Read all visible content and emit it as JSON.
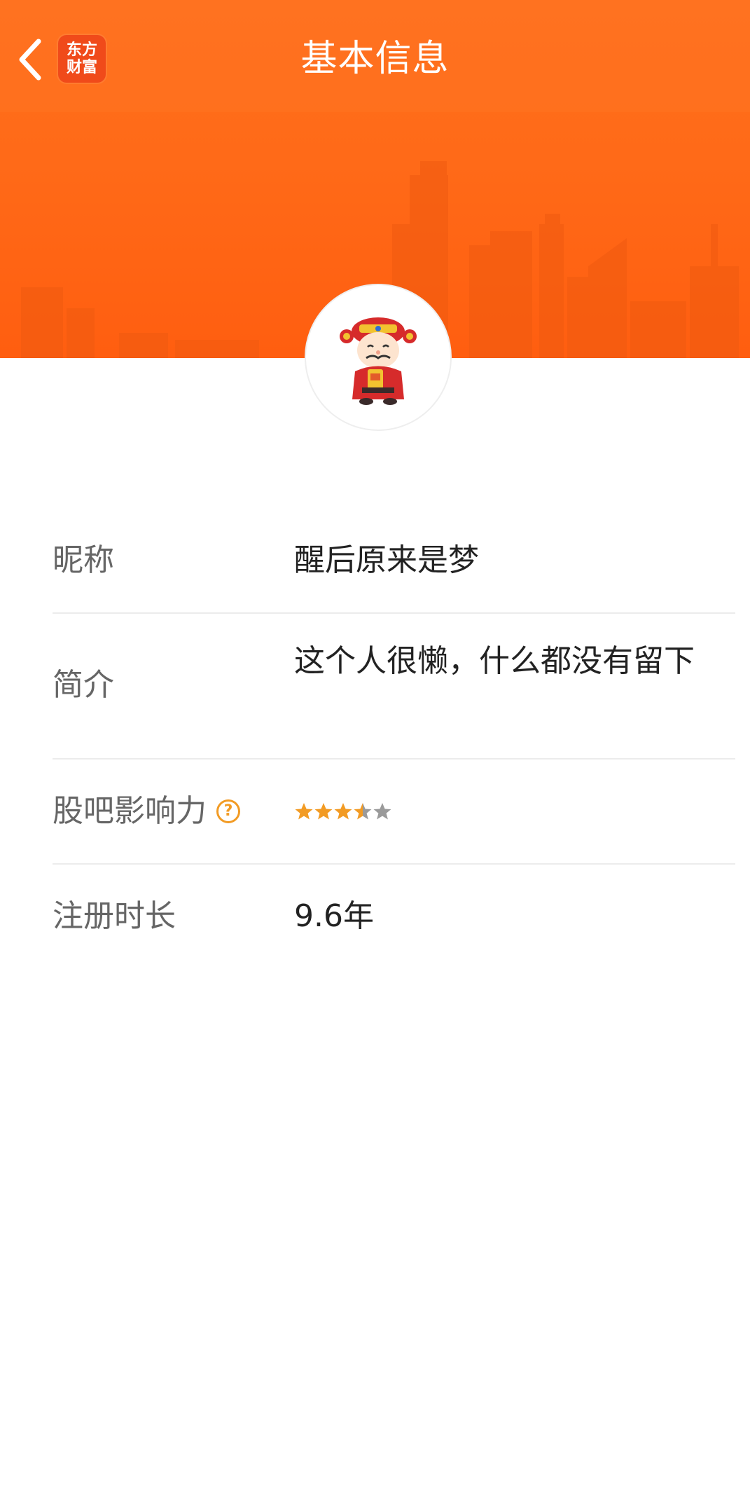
{
  "header": {
    "title": "基本信息",
    "back_icon": "chevron-left-icon",
    "logo": {
      "line1": "东方",
      "line2": "财富"
    }
  },
  "avatar": {
    "icon": "caishen-avatar-icon"
  },
  "info": {
    "nickname": {
      "label": "昵称",
      "value": "醒后原来是梦"
    },
    "bio": {
      "label": "简介",
      "value": "这个人很懒，什么都没有留下"
    },
    "influence": {
      "label": "股吧影响力",
      "help_symbol": "?",
      "rating": 3.5,
      "max": 5
    },
    "registration": {
      "label": "注册时长",
      "value": "9.6年"
    }
  },
  "colors": {
    "brand_orange": "#ff6a18",
    "star_active": "#f29b24",
    "star_inactive": "#9a9a9a",
    "label_text": "#666666",
    "value_text": "#222222",
    "divider": "#ececec"
  }
}
